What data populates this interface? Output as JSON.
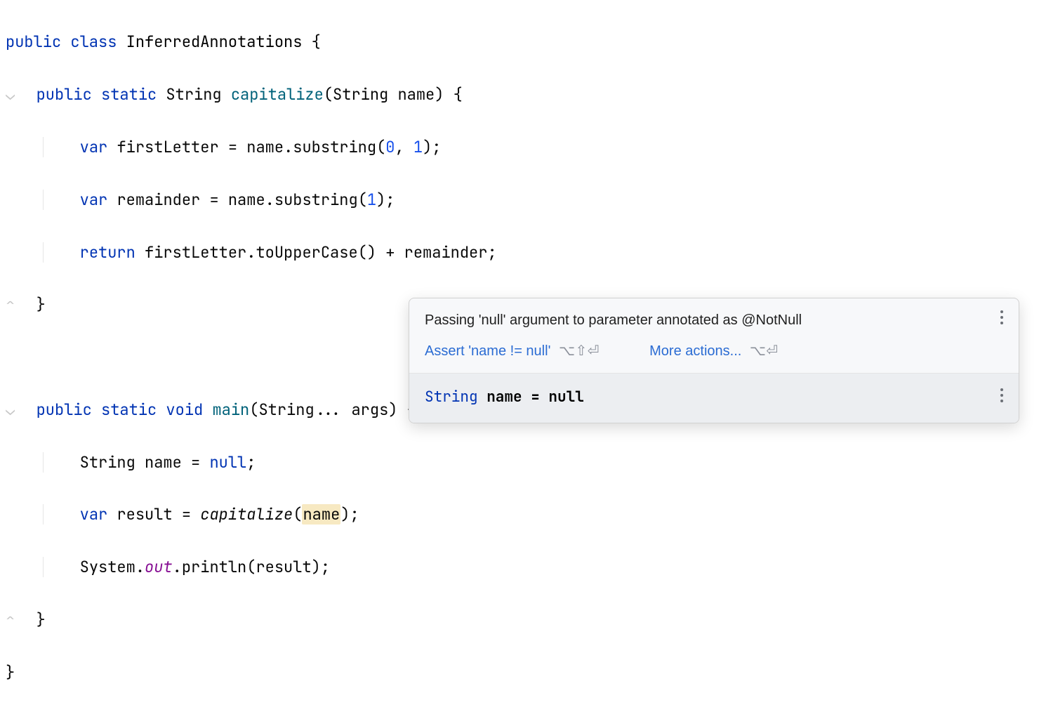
{
  "code": {
    "line1": {
      "kw_public": "public",
      "kw_class": "class",
      "classname": "InferredAnnotations",
      "brace": "{"
    },
    "line2": {
      "kw_public": "public",
      "kw_static": "static",
      "ret_type": "String",
      "method": "capitalize",
      "param_type": "String",
      "param_name": "name",
      "tail": ") {"
    },
    "line3": {
      "kw_var": "var",
      "var_name": "firstLetter",
      "eq": " = ",
      "obj": "name",
      "dot": ".",
      "call": "substring",
      "open": "(",
      "arg0": "0",
      "comma": ", ",
      "arg1": "1",
      "close": ");"
    },
    "line4": {
      "kw_var": "var",
      "var_name": "remainder",
      "eq": " = ",
      "obj": "name",
      "dot": ".",
      "call": "substring",
      "open": "(",
      "arg0": "1",
      "close": ");"
    },
    "line5": {
      "kw_return": "return",
      "expr_a": "firstLetter",
      "dot": ".",
      "call": "toUpperCase",
      "parens": "()",
      "plus": " + ",
      "expr_b": "remainder",
      "semi": ";"
    },
    "line6": {
      "brace": "}"
    },
    "line7": {
      "blank": ""
    },
    "line8": {
      "kw_public": "public",
      "kw_static": "static",
      "kw_void": "void",
      "method": "main",
      "param_type": "String",
      "varargs": "... ",
      "param_name": "args",
      "tail": ") {"
    },
    "line9": {
      "type": "String",
      "var_name": "name",
      "eq": " = ",
      "null": "null",
      "semi": ";"
    },
    "line10": {
      "kw_var": "var",
      "var_name": "result",
      "eq": " = ",
      "call": "capitalize",
      "open": "(",
      "arg": "name",
      "close": ");"
    },
    "line11": {
      "cls": "System",
      "dot": ".",
      "field": "out",
      "dot2": ".",
      "call": "println",
      "open": "(",
      "arg": "result",
      "close": ");"
    },
    "line12": {
      "brace": "}"
    },
    "line13": {
      "brace": "}"
    }
  },
  "tooltip": {
    "message": "Passing 'null' argument to parameter annotated as @NotNull",
    "action1_label": "Assert 'name != null'",
    "action1_shortcut": "⌥⇧⏎",
    "action2_label": "More actions...",
    "action2_shortcut": "⌥⏎",
    "preview_type": "String",
    "preview_rest": " name = null"
  }
}
